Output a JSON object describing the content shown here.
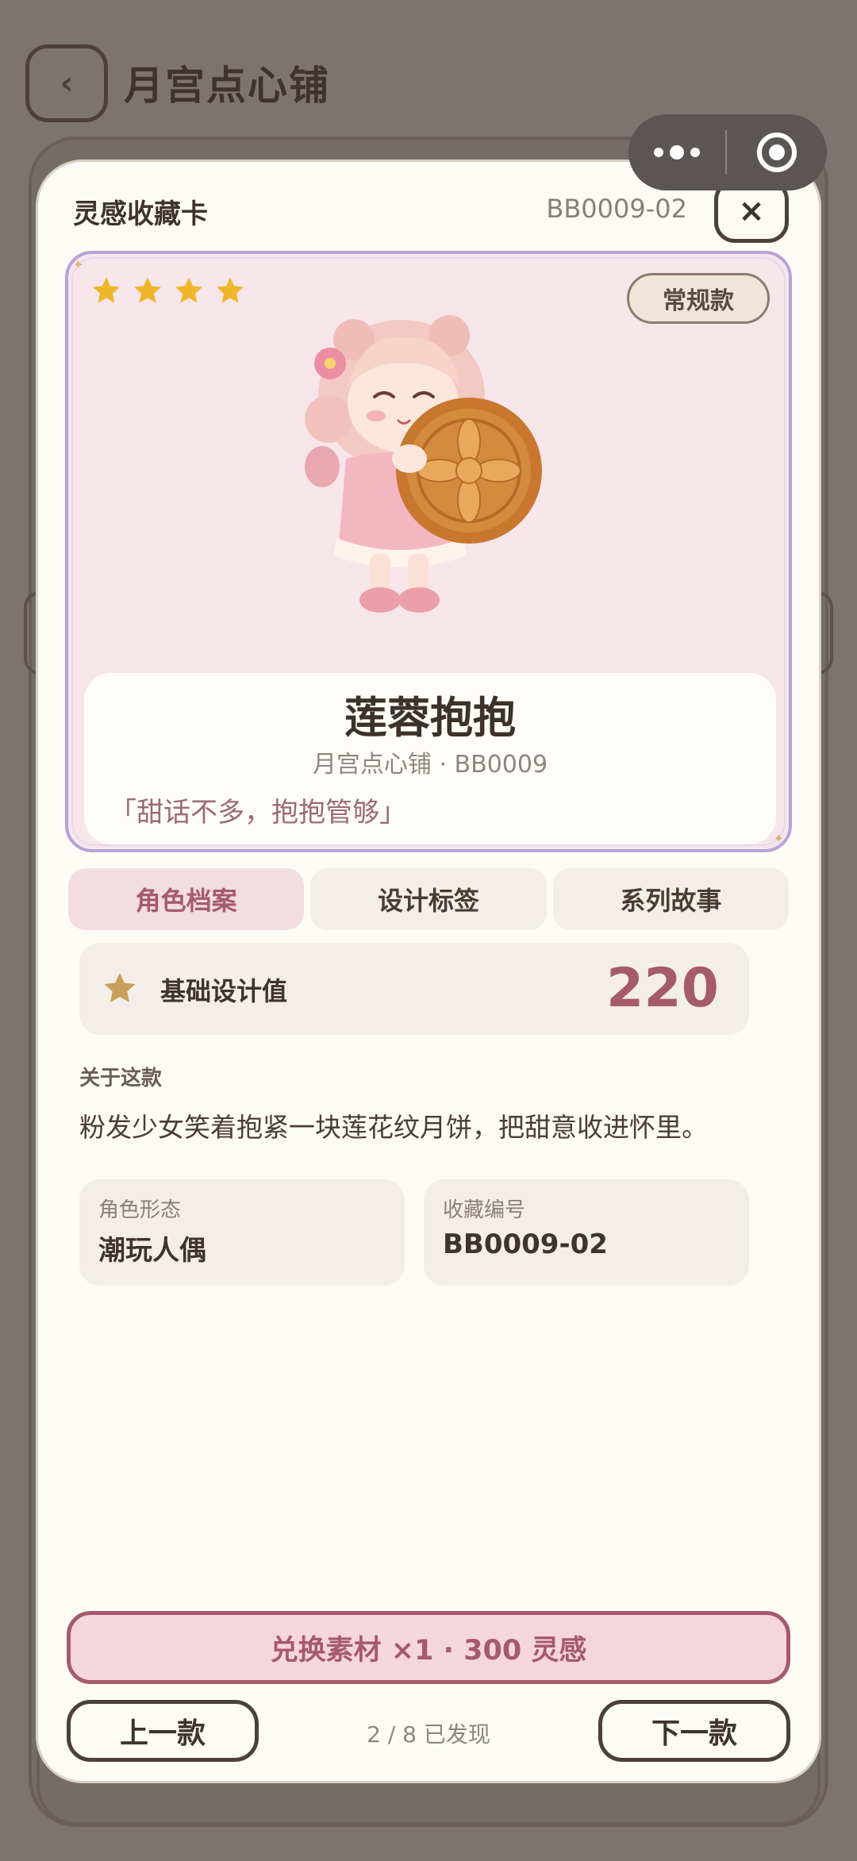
{
  "background": {
    "back_icon": "chevron-left-icon",
    "title": "月宫点心铺"
  },
  "capsule": {
    "more_icon": "more-dots-icon",
    "close_icon": "target-circle-icon"
  },
  "modal": {
    "title": "灵感收藏卡",
    "code": "BB0009-02",
    "close_label": "×"
  },
  "card": {
    "stars": 4,
    "badge": "常规款",
    "name": "莲蓉抱抱",
    "subtitle": "月宫点心铺 · BB0009",
    "quote": "「甜话不多，抱抱管够」"
  },
  "tabs": [
    {
      "label": "角色档案",
      "active": true
    },
    {
      "label": "设计标签",
      "active": false
    },
    {
      "label": "系列故事",
      "active": false
    }
  ],
  "stat": {
    "label": "基础设计值",
    "value": "220"
  },
  "about": {
    "label": "关于这款",
    "text": "粉发少女笑着抱紧一块莲花纹月饼，把甜意收进怀里。"
  },
  "details": [
    {
      "label": "角色形态",
      "value": "潮玩人偶"
    },
    {
      "label": "收藏编号",
      "value": "BB0009-02"
    }
  ],
  "actions": {
    "exchange": "兑换素材 ×1 · 300 灵感",
    "prev": "上一款",
    "next": "下一款",
    "progress": "2 / 8 已发现"
  },
  "colors": {
    "accent": "#a55a6e",
    "star": "#f0b62a",
    "card_border": "#b7a2d8"
  }
}
